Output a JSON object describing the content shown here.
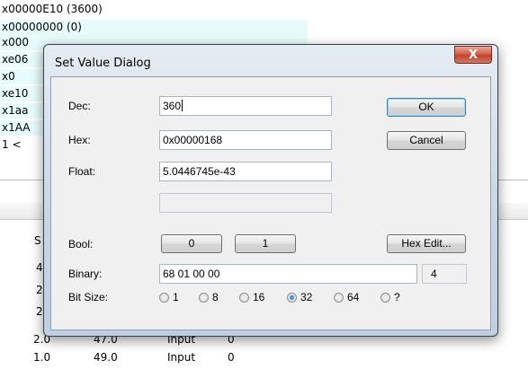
{
  "background": {
    "lines": [
      "x00000E10 (3600)",
      "x00000000 (0)",
      "x000",
      "xe06",
      "x0",
      "xe10",
      "x1aa",
      "x1AA",
      "1 <"
    ],
    "table_header_first": "S",
    "left_fragments": [
      "4",
      "2",
      "2"
    ],
    "rows": [
      {
        "c1": "2.0",
        "c2": "47.0",
        "c3": "Input",
        "c4": "0"
      },
      {
        "c1": "1.0",
        "c2": "49.0",
        "c3": "Input",
        "c4": "0"
      }
    ]
  },
  "dialog": {
    "title": "Set Value Dialog",
    "close_label": "X",
    "labels": {
      "dec": "Dec:",
      "hex": "Hex:",
      "float": "Float:",
      "bool": "Bool:",
      "binary": "Binary:",
      "bit_size": "Bit Size:"
    },
    "fields": {
      "dec": "360",
      "hex": "0x00000168",
      "float": "5.0446745e-43",
      "blank": "",
      "binary": "68 01 00 00",
      "byte_count": "4"
    },
    "buttons": {
      "ok": "OK",
      "cancel": "Cancel",
      "bool_0": "0",
      "bool_1": "1",
      "hex_edit": "Hex Edit..."
    },
    "bit_sizes": [
      {
        "label": "1",
        "selected": false
      },
      {
        "label": "8",
        "selected": false
      },
      {
        "label": "16",
        "selected": false
      },
      {
        "label": "32",
        "selected": true
      },
      {
        "label": "64",
        "selected": false
      },
      {
        "label": "?",
        "selected": false
      }
    ]
  }
}
